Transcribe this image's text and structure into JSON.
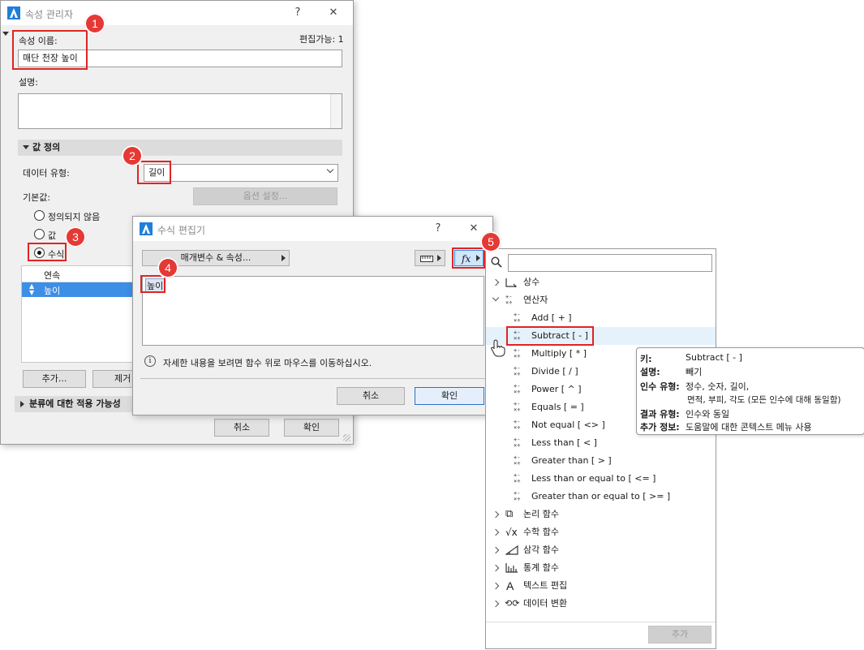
{
  "attr_manager": {
    "title": "속성 관리자",
    "help": "?",
    "close": "✕",
    "name_label": "속성 이름:",
    "editable": "편집가능: 1",
    "name_value": "매단 천장 높이",
    "desc_label": "설명:",
    "value_def_section": "값 정의",
    "data_type_label": "데이터 유형:",
    "data_type_value": "길이",
    "default_label": "기본값:",
    "options_button": "옵션 설정...",
    "radio_undefined": "정의되지 않음",
    "radio_value": "값",
    "radio_formula": "수식",
    "list_header": "연속",
    "list_item": "높이",
    "add_button": "추가...",
    "remove_button": "제거",
    "classification_section": "분류에 대한 적용 가능성",
    "cancel": "취소",
    "ok": "확인"
  },
  "formula_editor": {
    "title": "수식 편집기",
    "help": "?",
    "close": "✕",
    "params_button": "매개변수 & 속성...",
    "units_icon": "ruler-icon",
    "fx_label": "fx",
    "formula_text": "높이",
    "info_text": "자세한 내용을 보려면 함수 위로 마우스를 이동하십시오.",
    "cancel": "취소",
    "ok": "확인"
  },
  "function_panel": {
    "search_placeholder": "",
    "categories": {
      "constants": "상수",
      "operators": "연산자",
      "logic": "논리 함수",
      "math": "수학 함수",
      "trig": "삼각 함수",
      "stats": "통계 함수",
      "text": "텍스트 편집",
      "convert": "데이터 변환"
    },
    "operators": [
      "Add  [ + ]",
      "Subtract  [ - ]",
      "Multiply  [ * ]",
      "Divide  [ / ]",
      "Power  [ ^ ]",
      "Equals  [ = ]",
      "Not equal  [ <> ]",
      "Less than  [ < ]",
      "Greater than  [ > ]",
      "Less than or equal to  [ <= ]",
      "Greater than or equal to  [ >= ]"
    ],
    "add_button": "추가"
  },
  "tooltip": {
    "key_label": "키:",
    "key_value": "Subtract  [ - ]",
    "desc_label": "설명:",
    "desc_value": "빼기",
    "arg_label": "인수 유형:",
    "arg_value_1": "정수, 숫자, 길이,",
    "arg_value_2": "면적, 부피, 각도 (모든 인수에 대해 동일함)",
    "result_label": "결과 유형:",
    "result_value": "인수와 동일",
    "extra_label": "추가 정보:",
    "extra_value": "도움말에 대한 콘텍스트 메뉴 사용"
  },
  "badges": [
    "1",
    "2",
    "3",
    "4",
    "5"
  ],
  "colors": {
    "accent_red": "#e02424",
    "badge_red": "#e53935",
    "selection_blue": "#3d8ee6",
    "hover_blue": "#e5f1fb"
  }
}
